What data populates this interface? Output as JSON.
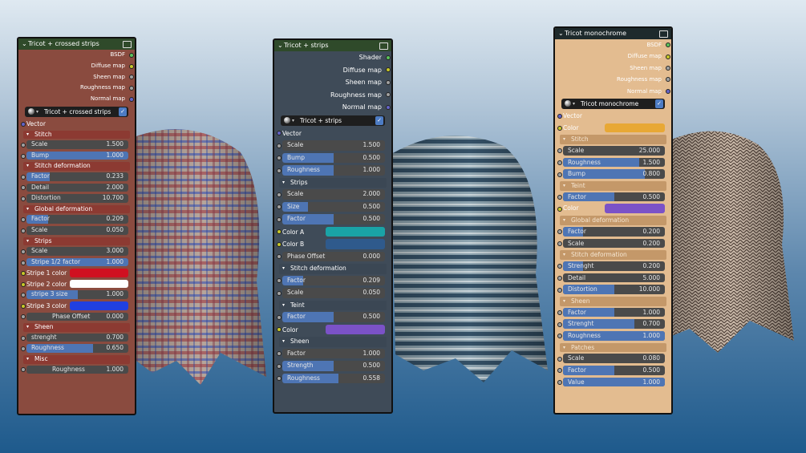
{
  "nodes": [
    {
      "id": "n1",
      "title": "Tricot + crossed strips",
      "outputs": [
        {
          "label": "BSDF",
          "color": "#5ac25a"
        },
        {
          "label": "Diffuse map",
          "color": "#c8c829"
        },
        {
          "label": "Sheen map",
          "color": "#a1a1a1"
        },
        {
          "label": "Roughness map",
          "color": "#a1a1a1"
        },
        {
          "label": "Normal map",
          "color": "#6363c7"
        }
      ],
      "selector": "Tricot + crossed strips",
      "rows": [
        {
          "t": "in",
          "label": "Vector"
        },
        {
          "t": "sec",
          "label": "Stitch"
        },
        {
          "t": "f",
          "label": "Scale",
          "value": "1.500",
          "fill": 0
        },
        {
          "t": "f",
          "label": "Bump",
          "value": "1.000",
          "fill": 1
        },
        {
          "t": "sec",
          "label": "Stitch deformation"
        },
        {
          "t": "f",
          "label": "Factor",
          "value": "0.233",
          "fill": 0.23
        },
        {
          "t": "f",
          "label": "Detail",
          "value": "2.000",
          "fill": 0
        },
        {
          "t": "f",
          "label": "Distortion",
          "value": "10.700",
          "fill": 0
        },
        {
          "t": "sec",
          "label": "Global deformation"
        },
        {
          "t": "f",
          "label": "Factor",
          "value": "0.209",
          "fill": 0.21
        },
        {
          "t": "f",
          "label": "Scale",
          "value": "0.050",
          "fill": 0
        },
        {
          "t": "sec",
          "label": "Strips"
        },
        {
          "t": "f",
          "label": "Scale",
          "value": "3.000",
          "fill": 0
        },
        {
          "t": "f",
          "label": "Stripe 1/2 factor",
          "value": "1.000",
          "fill": 1
        },
        {
          "t": "c",
          "label": "Stripe 1 color",
          "color": "#d01020"
        },
        {
          "t": "c",
          "label": "Stripe 2 color",
          "color": "#ffffff"
        },
        {
          "t": "f",
          "label": "stripe 3 size",
          "value": "1.000",
          "fill": 0.5
        },
        {
          "t": "c",
          "label": "Stripe 3 color",
          "color": "#2040e0"
        },
        {
          "t": "f",
          "label": "Phase Offset",
          "value": "0.000",
          "fill": 0,
          "center": true
        },
        {
          "t": "sec",
          "label": "Sheen"
        },
        {
          "t": "f",
          "label": "strenght",
          "value": "0.700",
          "fill": 0
        },
        {
          "t": "f",
          "label": "Roughness",
          "value": "0.650",
          "fill": 0.65
        },
        {
          "t": "sec",
          "label": "Misc"
        },
        {
          "t": "f",
          "label": "Roughness",
          "value": "1.000",
          "fill": 0,
          "center": true
        }
      ]
    },
    {
      "id": "n2",
      "title": "Tricot + strips",
      "outputs": [
        {
          "label": "Shader",
          "color": "#5ac25a"
        },
        {
          "label": "Diffuse map",
          "color": "#c8c829"
        },
        {
          "label": "Sheen map",
          "color": "#a1a1a1"
        },
        {
          "label": "Roughness map",
          "color": "#a1a1a1"
        },
        {
          "label": "Normal map",
          "color": "#6363c7"
        }
      ],
      "selector": "Tricot + strips",
      "rows": [
        {
          "t": "in",
          "label": "Vector"
        },
        {
          "t": "f",
          "label": "Scale",
          "value": "1.500",
          "fill": 0
        },
        {
          "t": "f",
          "label": "Bump",
          "value": "0.500",
          "fill": 0.5
        },
        {
          "t": "f",
          "label": "Roughness",
          "value": "1.000",
          "fill": 0.5
        },
        {
          "t": "sec",
          "label": "Strips"
        },
        {
          "t": "f",
          "label": "Scale",
          "value": "2.000",
          "fill": 0
        },
        {
          "t": "f",
          "label": "Size",
          "value": "0.500",
          "fill": 0.25
        },
        {
          "t": "f",
          "label": "Factor",
          "value": "0.500",
          "fill": 0.5
        },
        {
          "t": "c",
          "label": "Color A",
          "color": "#1aa3a6"
        },
        {
          "t": "c",
          "label": "Color B",
          "color": "#2f5a8c"
        },
        {
          "t": "f",
          "label": "Phase Offset",
          "value": "0.000",
          "fill": 0
        },
        {
          "t": "sec",
          "label": "Stitch deformation"
        },
        {
          "t": "f",
          "label": "Factor",
          "value": "0.209",
          "fill": 0.2
        },
        {
          "t": "f",
          "label": "Scale",
          "value": "0.050",
          "fill": 0
        },
        {
          "t": "sec",
          "label": "Teint"
        },
        {
          "t": "f",
          "label": "Factor",
          "value": "0.500",
          "fill": 0.5
        },
        {
          "t": "c",
          "label": "Color",
          "color": "#7b52c7"
        },
        {
          "t": "sec",
          "label": "Sheen"
        },
        {
          "t": "f",
          "label": "Factor",
          "value": "1.000",
          "fill": 0
        },
        {
          "t": "f",
          "label": "Strength",
          "value": "0.500",
          "fill": 0.5
        },
        {
          "t": "f",
          "label": "Roughness",
          "value": "0.558",
          "fill": 0.55
        }
      ]
    },
    {
      "id": "n3",
      "title": "Tricot monochrome",
      "outputs": [
        {
          "label": "BSDF",
          "color": "#5ac25a"
        },
        {
          "label": "Diffuse map",
          "color": "#c8c829"
        },
        {
          "label": "Sheen map",
          "color": "#a1a1a1"
        },
        {
          "label": "Roughness map",
          "color": "#a1a1a1"
        },
        {
          "label": "Normal map",
          "color": "#6363c7"
        }
      ],
      "selector": "Tricot monochrome",
      "rows": [
        {
          "t": "in",
          "label": "Vector"
        },
        {
          "t": "c",
          "label": "Color",
          "color": "#e8a835"
        },
        {
          "t": "sec",
          "label": "Stitch"
        },
        {
          "t": "f",
          "label": "Scale",
          "value": "25.000",
          "fill": 0
        },
        {
          "t": "f",
          "label": "Roughness",
          "value": "1.500",
          "fill": 0.75
        },
        {
          "t": "f",
          "label": "Bump",
          "value": "0.800",
          "fill": 0.8
        },
        {
          "t": "sec",
          "label": "Teint"
        },
        {
          "t": "f",
          "label": "Factor",
          "value": "0.500",
          "fill": 0.5
        },
        {
          "t": "c",
          "label": "Color",
          "color": "#7b52c7"
        },
        {
          "t": "sec",
          "label": "Global deformation"
        },
        {
          "t": "f",
          "label": "Factor",
          "value": "0.200",
          "fill": 0.2
        },
        {
          "t": "f",
          "label": "Scale",
          "value": "0.200",
          "fill": 0
        },
        {
          "t": "sec",
          "label": "Stitch deformation"
        },
        {
          "t": "f",
          "label": "Strenght",
          "value": "0.200",
          "fill": 0.2
        },
        {
          "t": "f",
          "label": "Detail",
          "value": "5.000",
          "fill": 0
        },
        {
          "t": "f",
          "label": "Distortion",
          "value": "10.000",
          "fill": 0.5
        },
        {
          "t": "sec",
          "label": "Sheen"
        },
        {
          "t": "f",
          "label": "Factor",
          "value": "1.000",
          "fill": 0.5
        },
        {
          "t": "f",
          "label": "Strenght",
          "value": "0.700",
          "fill": 0.7
        },
        {
          "t": "f",
          "label": "Roughness",
          "value": "1.000",
          "fill": 1
        },
        {
          "t": "sec",
          "label": "Patches"
        },
        {
          "t": "f",
          "label": "Scale",
          "value": "0.080",
          "fill": 0
        },
        {
          "t": "f",
          "label": "Factor",
          "value": "0.500",
          "fill": 0.5
        },
        {
          "t": "f",
          "label": "Value",
          "value": "1.000",
          "fill": 1
        }
      ]
    }
  ]
}
